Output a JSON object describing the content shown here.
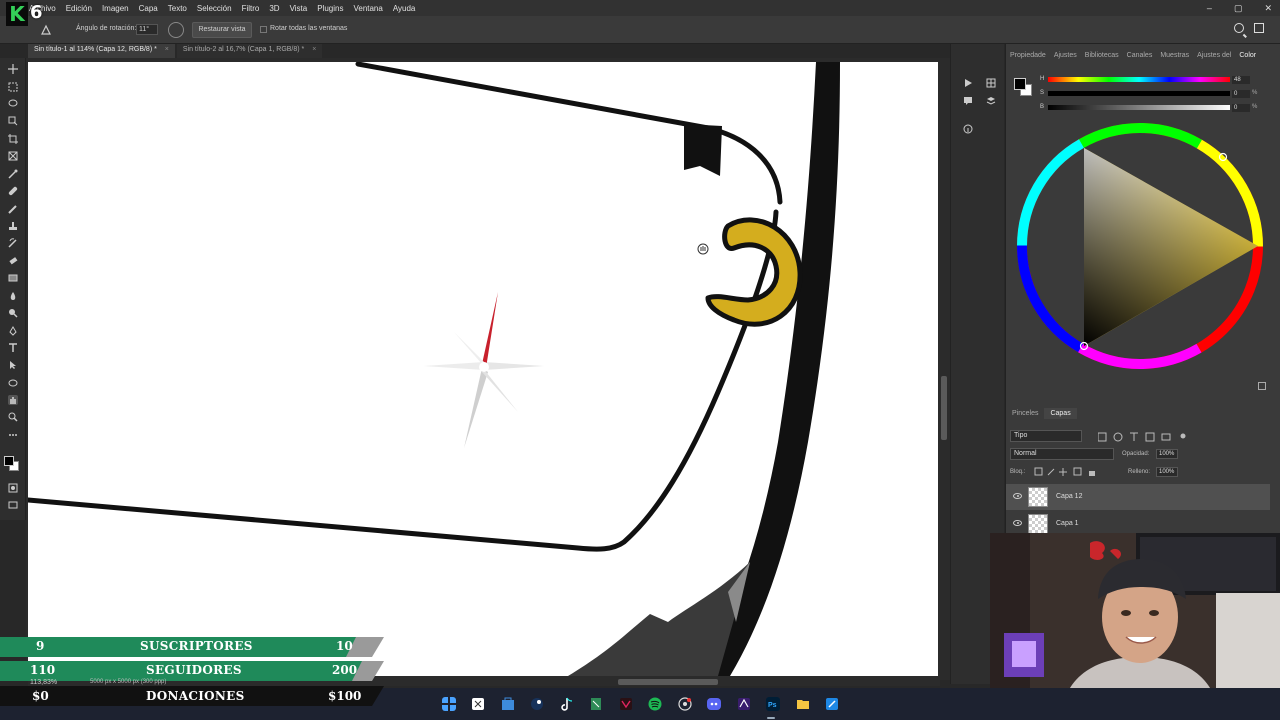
{
  "menu": {
    "items": [
      "Archivo",
      "Edición",
      "Imagen",
      "Capa",
      "Texto",
      "Selección",
      "Filtro",
      "3D",
      "Vista",
      "Plugins",
      "Ventana",
      "Ayuda"
    ],
    "window_controls": [
      "–",
      "▢",
      "✕"
    ]
  },
  "logo": {
    "letter": "K",
    "number": "6"
  },
  "options_bar": {
    "rotation_label": "Ángulo de rotación:",
    "rotation_value": "11°",
    "reset_view_label": "Restaurar vista",
    "rotate_all_label": "Rotar todas las ventanas"
  },
  "document_tabs": [
    {
      "label": "Sin título-1 al 114% (Capa 12, RGB/8) *",
      "active": true
    },
    {
      "label": "Sin título-2 al 16,7% (Capa 1, RGB/8) *",
      "active": false
    }
  ],
  "tab_close": "×",
  "toolbar_icons": [
    "move-icon",
    "marquee-icon",
    "lasso-icon",
    "object-select-icon",
    "crop-icon",
    "frame-icon",
    "eyedropper-icon",
    "healing-icon",
    "brush-icon",
    "stamp-icon",
    "history-brush-icon",
    "eraser-icon",
    "gradient-icon",
    "blur-icon",
    "dodge-icon",
    "pen-icon",
    "type-icon",
    "path-select-icon",
    "shape-icon",
    "hand-icon",
    "zoom-icon",
    "more-tools-icon"
  ],
  "right_panel": {
    "tabs": [
      "Propiedade",
      "Ajustes",
      "Bibliotecas",
      "Canales",
      "Muestras",
      "Ajustes del",
      "Color"
    ],
    "active_tab": "Color",
    "sliders": [
      {
        "label": "H",
        "value": "48",
        "unit": ""
      },
      {
        "label": "S",
        "value": "0",
        "unit": "%"
      },
      {
        "label": "B",
        "value": "0",
        "unit": "%"
      }
    ]
  },
  "layers_panel": {
    "tabs": [
      "Pinceles",
      "Capas"
    ],
    "active_tab": "Capas",
    "filter_label": "Tipo",
    "blend_mode": "Normal",
    "opacity_label": "Opacidad:",
    "opacity_value": "100%",
    "lock_label": "Bloq.:",
    "fill_label": "Relleno:",
    "fill_value": "100%",
    "layers": [
      {
        "name": "Capa 12",
        "selected": true
      },
      {
        "name": "Capa 1",
        "selected": false
      }
    ]
  },
  "status": {
    "zoom": "113,83%",
    "dimensions": "5000 px x 5000 px (300 ppp)"
  },
  "overlay": {
    "subscribers": {
      "current": "9",
      "label": "SUSCRIPTORES",
      "goal": "10",
      "color": "#1f8a5a"
    },
    "followers": {
      "current": "110",
      "label": "SEGUIDORES",
      "goal": "200",
      "color": "#1f8a5a"
    },
    "donations": {
      "current": "$0",
      "label": "DONACIONES",
      "goal": "$100"
    }
  },
  "taskbar_icons": [
    "windows-start-icon",
    "snipping-tool-icon",
    "store-icon",
    "steam-icon",
    "tiktok-icon",
    "maps-icon",
    "app-icon",
    "spotify-icon",
    "browser-icon",
    "discord-icon",
    "app-icon-2",
    "photoshop-icon",
    "file-explorer-icon",
    "app-icon-3"
  ]
}
